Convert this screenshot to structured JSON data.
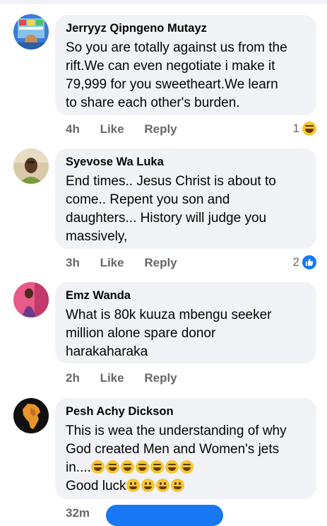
{
  "comments": [
    {
      "author": "Jerryyz Qipngeno Mutayz",
      "lines": [
        "So you are totally against us from the",
        "rift.We can even negotiate i make it",
        "79,999 for you sweetheart.We learn",
        "to share each other's burden."
      ],
      "time": "4h",
      "like_label": "Like",
      "reply_label": "Reply",
      "reaction_count": "1",
      "reaction_icon": "laugh-reaction-icon"
    },
    {
      "author": "Syevose Wa Luka",
      "lines": [
        "End times.. Jesus Christ is about to",
        "come.. Repent you son and",
        "daughters... History will judge you",
        "massively,"
      ],
      "time": "3h",
      "like_label": "Like",
      "reply_label": "Reply",
      "reaction_count": "2",
      "reaction_icon": "thumbs-up-reaction-icon"
    },
    {
      "author": "Emz Wanda",
      "lines": [
        "What is 80k kuuza mbengu seeker",
        "million alone spare donor",
        "harakaharaka"
      ],
      "time": "2h",
      "like_label": "Like",
      "reply_label": "Reply"
    },
    {
      "author": "Pesh Achy Dickson",
      "lines": [
        "This is wea the understanding of why",
        "God created Men and Women's jets",
        "in....",
        "Good luck"
      ],
      "time": "32m"
    }
  ],
  "colors": {
    "bubble": "#f0f2f5",
    "meta_text": "#65676b",
    "accent": "#1877f2",
    "emoji": "#f7c531"
  }
}
